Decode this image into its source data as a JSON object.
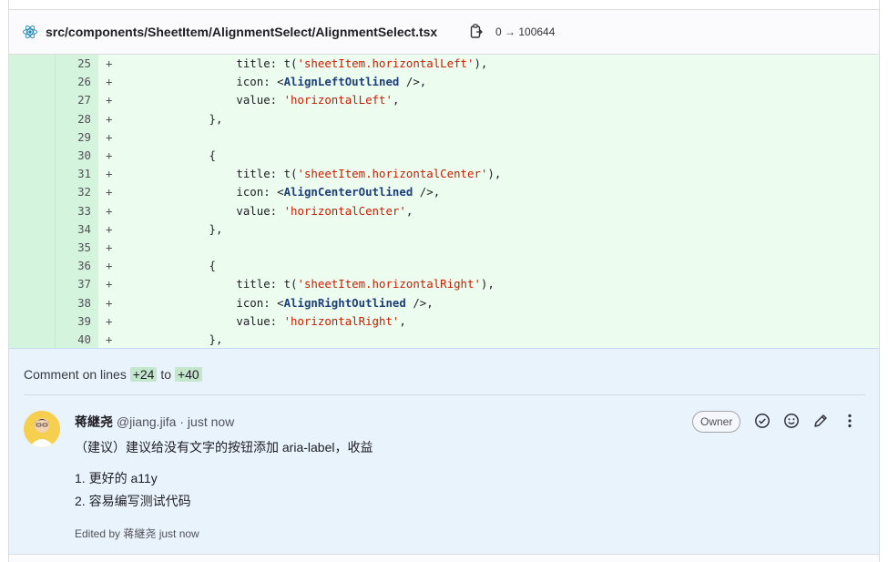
{
  "file": {
    "path": "src/components/SheetItem/AlignmentSelect/AlignmentSelect.tsx",
    "mode_change": "0 → 100644",
    "icon": "react-icon",
    "copy_icon": "copy-path-icon"
  },
  "diff": {
    "lines": [
      {
        "num": "25",
        "sign": "+",
        "code": [
          {
            "t": "                title: t(",
            "c": ""
          },
          {
            "t": "'sheetItem.horizontalLeft'",
            "c": "str"
          },
          {
            "t": "),",
            "c": ""
          }
        ]
      },
      {
        "num": "26",
        "sign": "+",
        "code": [
          {
            "t": "                icon: <",
            "c": ""
          },
          {
            "t": "AlignLeftOutlined",
            "c": "comp"
          },
          {
            "t": " />,",
            "c": ""
          }
        ]
      },
      {
        "num": "27",
        "sign": "+",
        "code": [
          {
            "t": "                value: ",
            "c": ""
          },
          {
            "t": "'horizontalLeft'",
            "c": "str"
          },
          {
            "t": ",",
            "c": ""
          }
        ]
      },
      {
        "num": "28",
        "sign": "+",
        "code": [
          {
            "t": "            },",
            "c": ""
          }
        ]
      },
      {
        "num": "29",
        "sign": "+",
        "code": [
          {
            "t": "",
            "c": ""
          }
        ]
      },
      {
        "num": "30",
        "sign": "+",
        "code": [
          {
            "t": "            {",
            "c": ""
          }
        ]
      },
      {
        "num": "31",
        "sign": "+",
        "code": [
          {
            "t": "                title: t(",
            "c": ""
          },
          {
            "t": "'sheetItem.horizontalCenter'",
            "c": "str"
          },
          {
            "t": "),",
            "c": ""
          }
        ]
      },
      {
        "num": "32",
        "sign": "+",
        "code": [
          {
            "t": "                icon: <",
            "c": ""
          },
          {
            "t": "AlignCenterOutlined",
            "c": "comp"
          },
          {
            "t": " />,",
            "c": ""
          }
        ]
      },
      {
        "num": "33",
        "sign": "+",
        "code": [
          {
            "t": "                value: ",
            "c": ""
          },
          {
            "t": "'horizontalCenter'",
            "c": "str"
          },
          {
            "t": ",",
            "c": ""
          }
        ]
      },
      {
        "num": "34",
        "sign": "+",
        "code": [
          {
            "t": "            },",
            "c": ""
          }
        ]
      },
      {
        "num": "35",
        "sign": "+",
        "code": [
          {
            "t": "",
            "c": ""
          }
        ]
      },
      {
        "num": "36",
        "sign": "+",
        "code": [
          {
            "t": "            {",
            "c": ""
          }
        ]
      },
      {
        "num": "37",
        "sign": "+",
        "code": [
          {
            "t": "                title: t(",
            "c": ""
          },
          {
            "t": "'sheetItem.horizontalRight'",
            "c": "str"
          },
          {
            "t": "),",
            "c": ""
          }
        ]
      },
      {
        "num": "38",
        "sign": "+",
        "code": [
          {
            "t": "                icon: <",
            "c": ""
          },
          {
            "t": "AlignRightOutlined",
            "c": "comp"
          },
          {
            "t": " />,",
            "c": ""
          }
        ]
      },
      {
        "num": "39",
        "sign": "+",
        "code": [
          {
            "t": "                value: ",
            "c": ""
          },
          {
            "t": "'horizontalRight'",
            "c": "str"
          },
          {
            "t": ",",
            "c": ""
          }
        ]
      },
      {
        "num": "40",
        "sign": "+",
        "code": [
          {
            "t": "            },",
            "c": ""
          }
        ]
      }
    ]
  },
  "comment_range": {
    "prefix": "Comment on lines",
    "start": "+24",
    "joiner": "to",
    "end": "+40"
  },
  "comment": {
    "author_name": "蒋継尧",
    "author_handle": "@jiang.jifa",
    "separator": "·",
    "time": "just now",
    "role_badge": "Owner",
    "body": "（建议）建议给没有文字的按钮添加 aria-label，收益",
    "list": [
      "1. 更好的 a11y",
      "2. 容易编写测试代码"
    ],
    "edited": "Edited by 蒋継尧 just now",
    "actions": [
      "resolve-thread-icon",
      "add-reaction-icon",
      "edit-icon",
      "more-actions-icon"
    ]
  },
  "colors": {
    "added_bg": "#ecfdf0",
    "added_gutter": "#d4f4dd",
    "string": "#c91c00",
    "component": "#1f3e78",
    "comment_bg": "#e9f3fc",
    "line_badge": "#c3e6cd"
  }
}
